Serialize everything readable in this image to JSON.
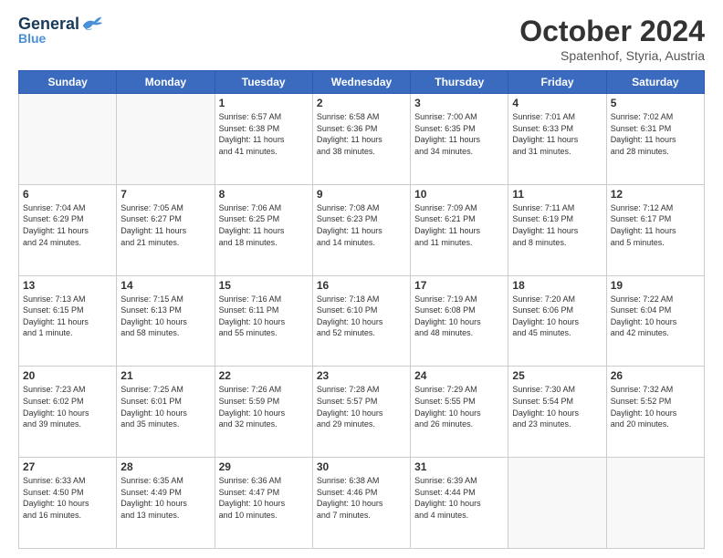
{
  "header": {
    "logo_line1": "General",
    "logo_line2": "Blue",
    "month": "October 2024",
    "location": "Spatenhof, Styria, Austria"
  },
  "weekdays": [
    "Sunday",
    "Monday",
    "Tuesday",
    "Wednesday",
    "Thursday",
    "Friday",
    "Saturday"
  ],
  "weeks": [
    [
      {
        "day": "",
        "info": ""
      },
      {
        "day": "",
        "info": ""
      },
      {
        "day": "1",
        "info": "Sunrise: 6:57 AM\nSunset: 6:38 PM\nDaylight: 11 hours\nand 41 minutes."
      },
      {
        "day": "2",
        "info": "Sunrise: 6:58 AM\nSunset: 6:36 PM\nDaylight: 11 hours\nand 38 minutes."
      },
      {
        "day": "3",
        "info": "Sunrise: 7:00 AM\nSunset: 6:35 PM\nDaylight: 11 hours\nand 34 minutes."
      },
      {
        "day": "4",
        "info": "Sunrise: 7:01 AM\nSunset: 6:33 PM\nDaylight: 11 hours\nand 31 minutes."
      },
      {
        "day": "5",
        "info": "Sunrise: 7:02 AM\nSunset: 6:31 PM\nDaylight: 11 hours\nand 28 minutes."
      }
    ],
    [
      {
        "day": "6",
        "info": "Sunrise: 7:04 AM\nSunset: 6:29 PM\nDaylight: 11 hours\nand 24 minutes."
      },
      {
        "day": "7",
        "info": "Sunrise: 7:05 AM\nSunset: 6:27 PM\nDaylight: 11 hours\nand 21 minutes."
      },
      {
        "day": "8",
        "info": "Sunrise: 7:06 AM\nSunset: 6:25 PM\nDaylight: 11 hours\nand 18 minutes."
      },
      {
        "day": "9",
        "info": "Sunrise: 7:08 AM\nSunset: 6:23 PM\nDaylight: 11 hours\nand 14 minutes."
      },
      {
        "day": "10",
        "info": "Sunrise: 7:09 AM\nSunset: 6:21 PM\nDaylight: 11 hours\nand 11 minutes."
      },
      {
        "day": "11",
        "info": "Sunrise: 7:11 AM\nSunset: 6:19 PM\nDaylight: 11 hours\nand 8 minutes."
      },
      {
        "day": "12",
        "info": "Sunrise: 7:12 AM\nSunset: 6:17 PM\nDaylight: 11 hours\nand 5 minutes."
      }
    ],
    [
      {
        "day": "13",
        "info": "Sunrise: 7:13 AM\nSunset: 6:15 PM\nDaylight: 11 hours\nand 1 minute."
      },
      {
        "day": "14",
        "info": "Sunrise: 7:15 AM\nSunset: 6:13 PM\nDaylight: 10 hours\nand 58 minutes."
      },
      {
        "day": "15",
        "info": "Sunrise: 7:16 AM\nSunset: 6:11 PM\nDaylight: 10 hours\nand 55 minutes."
      },
      {
        "day": "16",
        "info": "Sunrise: 7:18 AM\nSunset: 6:10 PM\nDaylight: 10 hours\nand 52 minutes."
      },
      {
        "day": "17",
        "info": "Sunrise: 7:19 AM\nSunset: 6:08 PM\nDaylight: 10 hours\nand 48 minutes."
      },
      {
        "day": "18",
        "info": "Sunrise: 7:20 AM\nSunset: 6:06 PM\nDaylight: 10 hours\nand 45 minutes."
      },
      {
        "day": "19",
        "info": "Sunrise: 7:22 AM\nSunset: 6:04 PM\nDaylight: 10 hours\nand 42 minutes."
      }
    ],
    [
      {
        "day": "20",
        "info": "Sunrise: 7:23 AM\nSunset: 6:02 PM\nDaylight: 10 hours\nand 39 minutes."
      },
      {
        "day": "21",
        "info": "Sunrise: 7:25 AM\nSunset: 6:01 PM\nDaylight: 10 hours\nand 35 minutes."
      },
      {
        "day": "22",
        "info": "Sunrise: 7:26 AM\nSunset: 5:59 PM\nDaylight: 10 hours\nand 32 minutes."
      },
      {
        "day": "23",
        "info": "Sunrise: 7:28 AM\nSunset: 5:57 PM\nDaylight: 10 hours\nand 29 minutes."
      },
      {
        "day": "24",
        "info": "Sunrise: 7:29 AM\nSunset: 5:55 PM\nDaylight: 10 hours\nand 26 minutes."
      },
      {
        "day": "25",
        "info": "Sunrise: 7:30 AM\nSunset: 5:54 PM\nDaylight: 10 hours\nand 23 minutes."
      },
      {
        "day": "26",
        "info": "Sunrise: 7:32 AM\nSunset: 5:52 PM\nDaylight: 10 hours\nand 20 minutes."
      }
    ],
    [
      {
        "day": "27",
        "info": "Sunrise: 6:33 AM\nSunset: 4:50 PM\nDaylight: 10 hours\nand 16 minutes."
      },
      {
        "day": "28",
        "info": "Sunrise: 6:35 AM\nSunset: 4:49 PM\nDaylight: 10 hours\nand 13 minutes."
      },
      {
        "day": "29",
        "info": "Sunrise: 6:36 AM\nSunset: 4:47 PM\nDaylight: 10 hours\nand 10 minutes."
      },
      {
        "day": "30",
        "info": "Sunrise: 6:38 AM\nSunset: 4:46 PM\nDaylight: 10 hours\nand 7 minutes."
      },
      {
        "day": "31",
        "info": "Sunrise: 6:39 AM\nSunset: 4:44 PM\nDaylight: 10 hours\nand 4 minutes."
      },
      {
        "day": "",
        "info": ""
      },
      {
        "day": "",
        "info": ""
      }
    ]
  ]
}
